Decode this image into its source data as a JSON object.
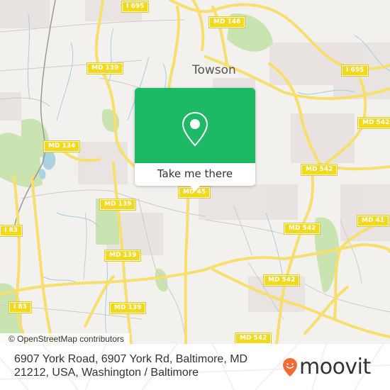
{
  "map": {
    "place_label": "Towson",
    "road_shields": [
      {
        "id": "i695-top",
        "label": "I 695"
      },
      {
        "id": "md146",
        "label": "MD 146"
      },
      {
        "id": "md139-nw",
        "label": "MD 139"
      },
      {
        "id": "i695-east",
        "label": "I 695"
      },
      {
        "id": "md542-ne",
        "label": "MD 542"
      },
      {
        "id": "md134",
        "label": "MD 134"
      },
      {
        "id": "md542-mid",
        "label": "MD 542"
      },
      {
        "id": "md45",
        "label": "MD 45"
      },
      {
        "id": "md139-w1",
        "label": "MD 139"
      },
      {
        "id": "i83-upper",
        "label": "I 83"
      },
      {
        "id": "md542-center",
        "label": "MD 542"
      },
      {
        "id": "md41",
        "label": "MD 41"
      },
      {
        "id": "md139-w2",
        "label": "MD 139"
      },
      {
        "id": "md542-south",
        "label": "MD 542"
      },
      {
        "id": "i83-lower",
        "label": "I 83"
      },
      {
        "id": "md139-w3",
        "label": "MD 139"
      },
      {
        "id": "md542-bottom",
        "label": "MD 542"
      }
    ],
    "attribution": "© OpenStreetMap contributors"
  },
  "popup": {
    "icon": "location-pin-icon",
    "cta_label": "Take me there",
    "accent_color": "#1db967"
  },
  "footer": {
    "address": "6907 York Road, 6907 York Rd, Baltimore, MD 21212, USA, Washington / Baltimore",
    "brand": "moovit",
    "brand_color": "#f26a36"
  }
}
